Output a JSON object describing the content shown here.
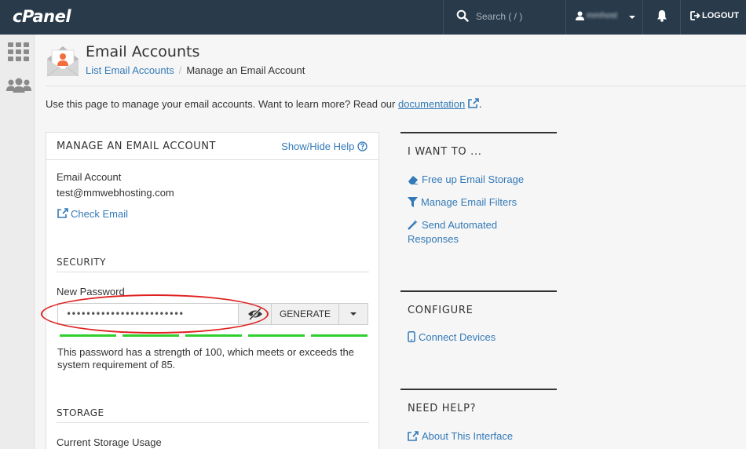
{
  "topbar": {
    "logo": "cPanel",
    "search_placeholder": "Search ( / )",
    "username": "mmhost",
    "logout_label": "LOGOUT"
  },
  "header": {
    "title": "Email Accounts",
    "breadcrumb": [
      "List Email Accounts",
      "Manage an Email Account"
    ]
  },
  "intro": {
    "text": "Use this page to manage your email accounts. Want to learn more? Read our ",
    "link": "documentation",
    "suffix": "."
  },
  "panel": {
    "title": "MANAGE AN EMAIL ACCOUNT",
    "help_link": "Show/Hide Help",
    "email_label": "Email Account",
    "email_value": "test@mmwebhosting.com",
    "check_email": "Check Email",
    "security_title": "SECURITY",
    "new_password_label": "New Password",
    "password_value": "••••••••••••••••••••••••",
    "generate_label": "GENERATE",
    "strength_text": "This password has a strength of 100, which meets or exceeds the system requirement of 85.",
    "storage_title": "STORAGE",
    "storage_usage_label": "Current Storage Usage"
  },
  "right": {
    "want_title": "I WANT TO ...",
    "want_items": [
      "Free up Email Storage",
      "Manage Email Filters",
      "Send Automated Responses"
    ],
    "configure_title": "CONFIGURE",
    "configure_items": [
      "Connect Devices"
    ],
    "help_title": "NEED HELP?",
    "help_items": [
      "About This Interface"
    ]
  },
  "colors": {
    "topbar": "#293a4a",
    "link": "#337ab7",
    "strength_meter": "#2fcf2f",
    "annotation": "#e02020"
  }
}
